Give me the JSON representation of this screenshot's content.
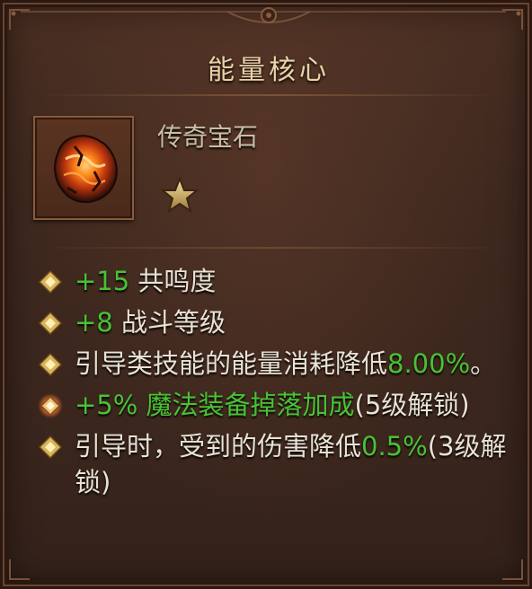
{
  "tooltip": {
    "title": "能量核心",
    "item_type": "传奇宝石",
    "rarity_stars": 1,
    "icons": {
      "gem": "legendary-gem-icon",
      "star": "star-icon",
      "bullet": "gold-diamond-bullet-icon",
      "bullet_special": "glowing-diamond-bullet-icon"
    },
    "colors": {
      "title": "#e9d3a8",
      "value_green": "#48c234",
      "text": "#e8e2d4",
      "type_text": "#c9bda7"
    },
    "affixes": [
      {
        "bullet": "gold",
        "prefix": "+15",
        "text": " 共鸣度",
        "suffix": ""
      },
      {
        "bullet": "gold",
        "prefix": "+8",
        "text": " 战斗等级",
        "suffix": ""
      },
      {
        "bullet": "gold",
        "prefix": "",
        "text": "引导类技能的能量消耗降低",
        "value": "8.00%",
        "suffix": "。"
      },
      {
        "bullet": "glow",
        "prefix": "+5%",
        "text": " 魔法装备掉落加成",
        "suffix": "(5级解锁)"
      },
      {
        "bullet": "gold",
        "prefix": "",
        "text": "引导时，受到的伤害降低",
        "value": "0.5%",
        "suffix": "(3级解锁)"
      }
    ]
  }
}
